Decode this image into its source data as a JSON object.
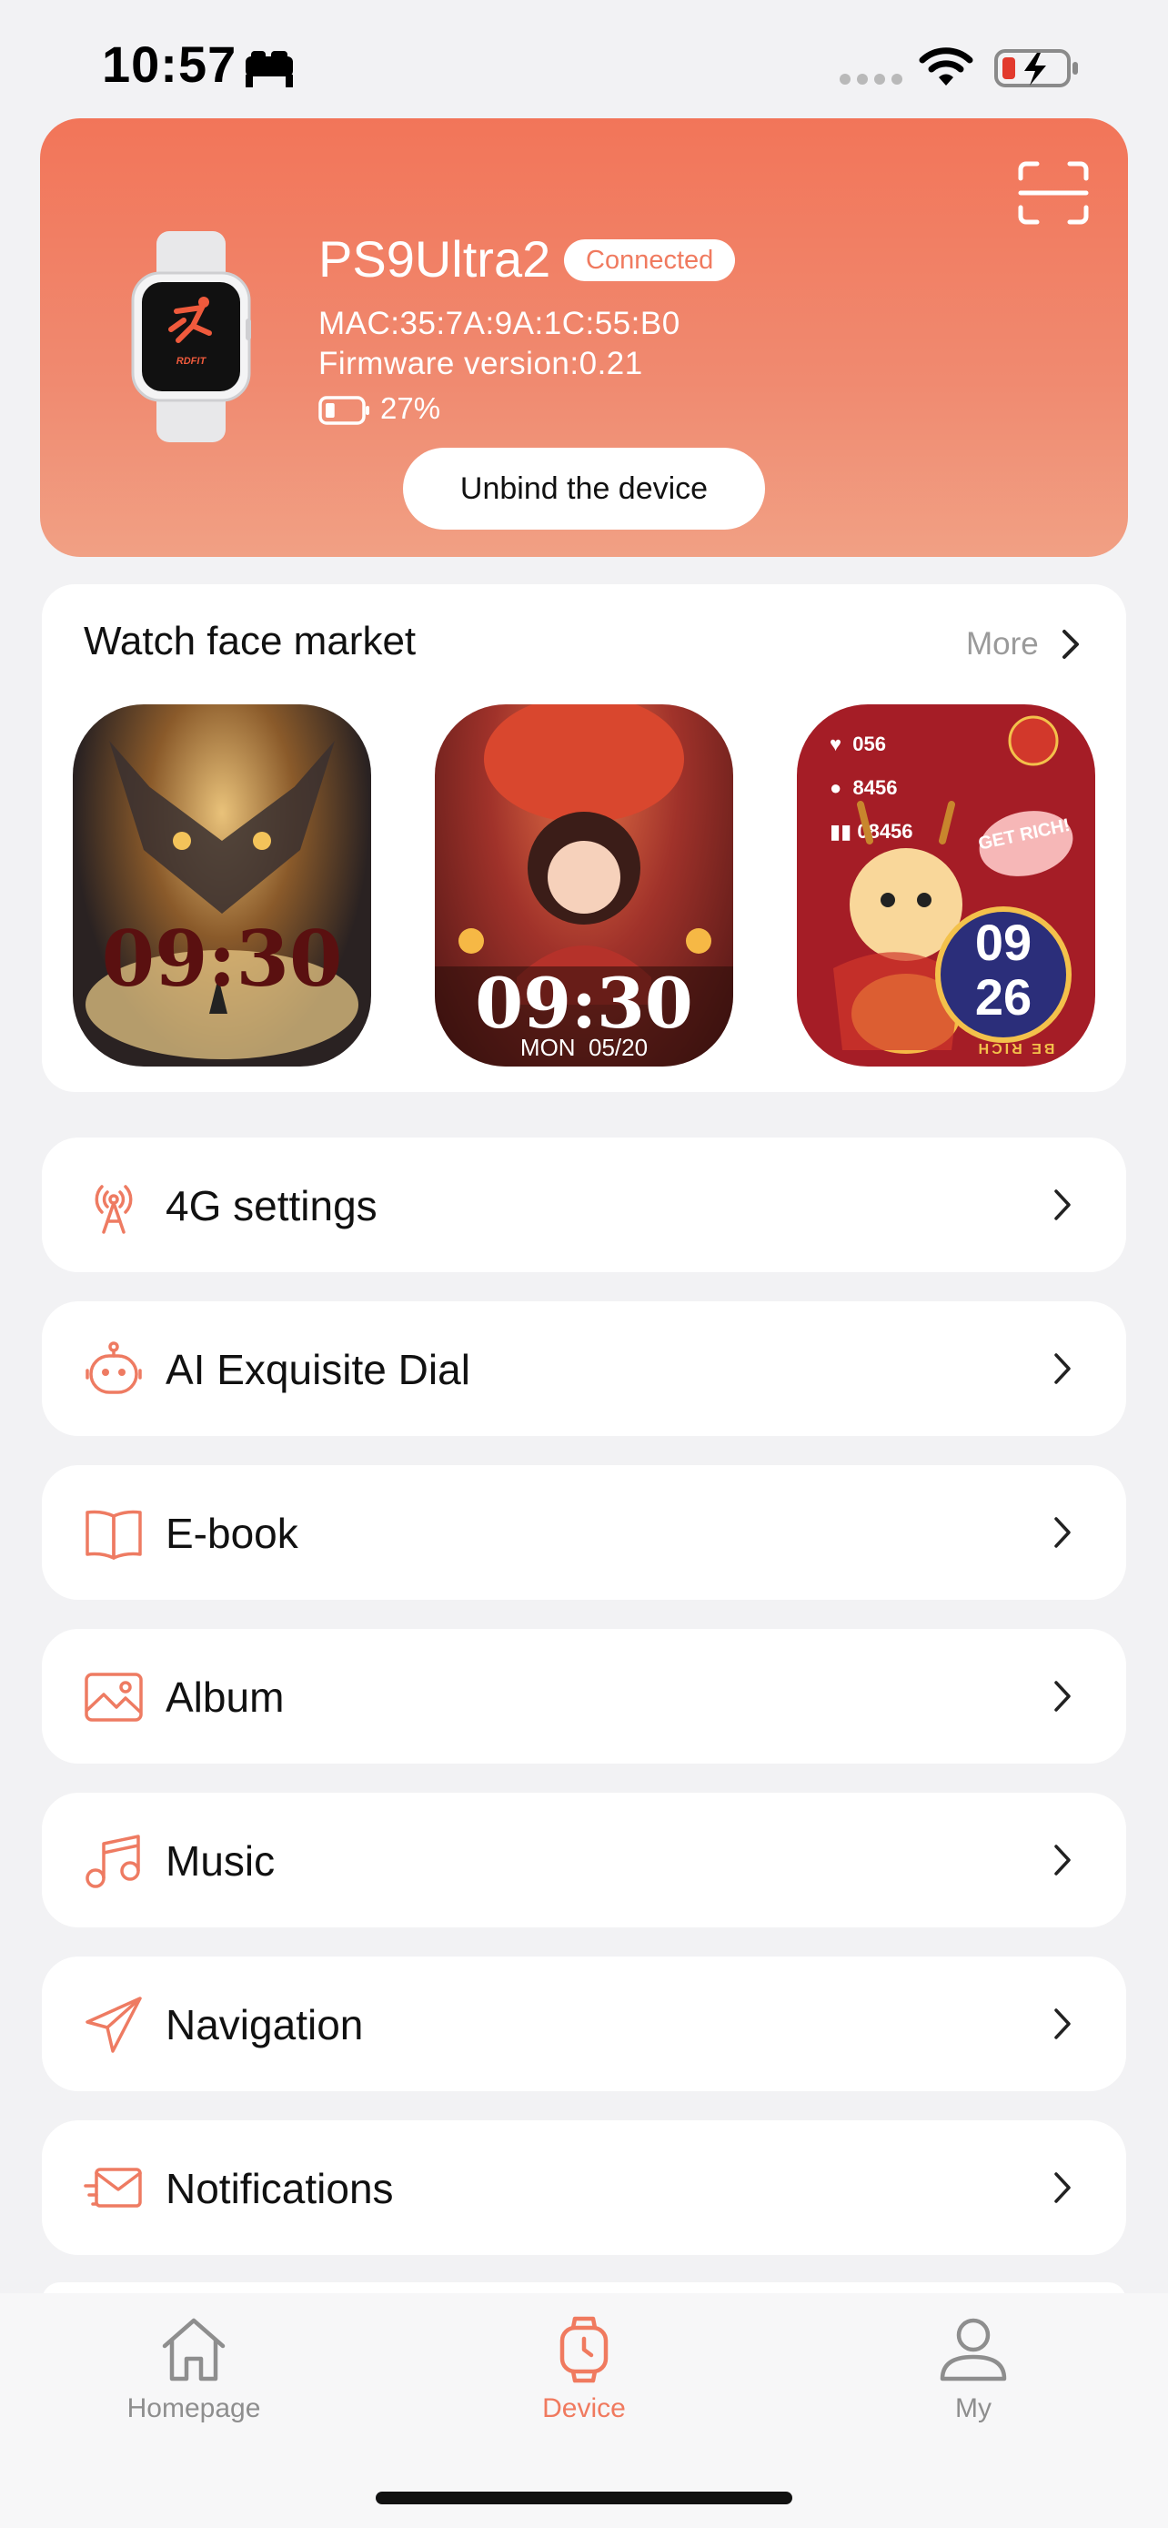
{
  "status_bar": {
    "time": "10:57"
  },
  "device": {
    "name": "PS9Ultra2",
    "status": "Connected",
    "mac": "MAC:35:7A:9A:1C:55:B0",
    "firmware": "Firmware version:0.21",
    "battery": "27%",
    "battery_level": 0.27,
    "unbind_label": "Unbind the device",
    "watch_brand": "RDFIT"
  },
  "market": {
    "title": "Watch face market",
    "more_label": "More",
    "faces": [
      {
        "time": "09:30"
      },
      {
        "time": "09:30",
        "date": "MON  05/20"
      },
      {
        "stats": [
          "056",
          "8456",
          "08456"
        ],
        "badge": "GET RICH!",
        "hour": "09",
        "minute": "26",
        "ring_text": "BE RICH"
      }
    ]
  },
  "menu": [
    {
      "label": "4G settings",
      "icon": "antenna-icon"
    },
    {
      "label": "AI Exquisite Dial",
      "icon": "robot-icon"
    },
    {
      "label": "E-book",
      "icon": "book-icon"
    },
    {
      "label": "Album",
      "icon": "image-icon"
    },
    {
      "label": "Music",
      "icon": "music-note-icon"
    },
    {
      "label": "Navigation",
      "icon": "paper-plane-icon"
    },
    {
      "label": "Notifications",
      "icon": "envelope-icon"
    }
  ],
  "tabs": [
    {
      "label": "Homepage",
      "active": false
    },
    {
      "label": "Device",
      "active": true
    },
    {
      "label": "My",
      "active": false
    }
  ],
  "colors": {
    "accent": "#f07a5f",
    "inactive": "#8e8e8e"
  }
}
